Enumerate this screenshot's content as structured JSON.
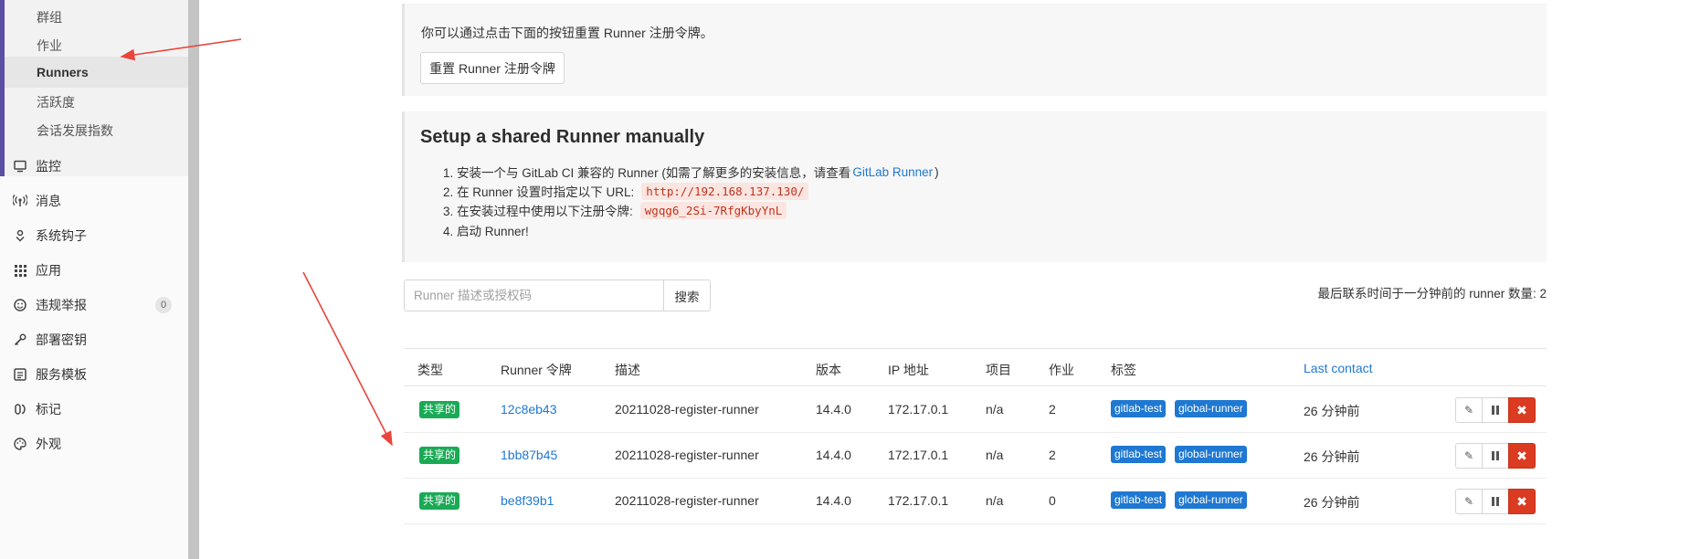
{
  "sidebar": {
    "sub_items": [
      {
        "label": "群组"
      },
      {
        "label": "作业"
      },
      {
        "label": "Runners"
      },
      {
        "label": "活跃度"
      },
      {
        "label": "会话发展指数"
      }
    ],
    "nav_items": [
      {
        "label": "监控",
        "icon": "monitor-icon"
      },
      {
        "label": "消息",
        "icon": "broadcast-icon"
      },
      {
        "label": "系统钩子",
        "icon": "hook-icon"
      },
      {
        "label": "应用",
        "icon": "apps-grid-icon"
      },
      {
        "label": "违规举报",
        "icon": "smiley-icon",
        "badge": "0"
      },
      {
        "label": "部署密钥",
        "icon": "key-icon"
      },
      {
        "label": "服务模板",
        "icon": "template-icon"
      },
      {
        "label": "标记",
        "icon": "labels-icon"
      },
      {
        "label": "外观",
        "icon": "palette-icon"
      }
    ]
  },
  "reset_panel": {
    "text": "你可以通过点击下面的按钮重置 Runner 注册令牌。",
    "button": "重置 Runner 注册令牌"
  },
  "setup_panel": {
    "title": "Setup a shared Runner manually",
    "step1_prefix": "1. 安装一个与 GitLab CI 兼容的 Runner (如需了解更多的安装信息，请查看",
    "step1_link": "GitLab Runner",
    "step1_suffix": ")",
    "step2_prefix": "2. 在 Runner 设置时指定以下 URL:",
    "step2_code": "http://192.168.137.130/",
    "step3_prefix": "3. 在安装过程中使用以下注册令牌:",
    "step3_code": "wgqg6_2Si-7RfgKbyYnL",
    "step4": "4. 启动 Runner!"
  },
  "search": {
    "placeholder": "Runner 描述或授权码",
    "button": "搜索"
  },
  "runner_count_text": "最后联系时间于一分钟前的 runner 数量: 2",
  "table": {
    "headers": {
      "type": "类型",
      "token": "Runner 令牌",
      "description": "描述",
      "version": "版本",
      "ip": "IP 地址",
      "projects": "项目",
      "jobs": "作业",
      "tags": "标签",
      "last_contact": "Last contact"
    },
    "rows": [
      {
        "type": "共享的",
        "token": "12c8eb43",
        "description": "20211028-register-runner",
        "version": "14.4.0",
        "ip": "172.17.0.1",
        "projects": "n/a",
        "jobs": "2",
        "tag1": "gitlab-test",
        "tag2": "global-runner",
        "last_contact": "26 分钟前"
      },
      {
        "type": "共享的",
        "token": "1bb87b45",
        "description": "20211028-register-runner",
        "version": "14.4.0",
        "ip": "172.17.0.1",
        "projects": "n/a",
        "jobs": "2",
        "tag1": "gitlab-test",
        "tag2": "global-runner",
        "last_contact": "26 分钟前"
      },
      {
        "type": "共享的",
        "token": "be8f39b1",
        "description": "20211028-register-runner",
        "version": "14.4.0",
        "ip": "172.17.0.1",
        "projects": "n/a",
        "jobs": "0",
        "tag1": "gitlab-test",
        "tag2": "global-runner",
        "last_contact": "26 分钟前"
      }
    ]
  },
  "colors": {
    "accent": "#5b4fa3",
    "link": "#1f78d1",
    "shared_badge": "#1aaa55",
    "delete": "#db3b21",
    "annotation_arrow": "#e8453c"
  }
}
